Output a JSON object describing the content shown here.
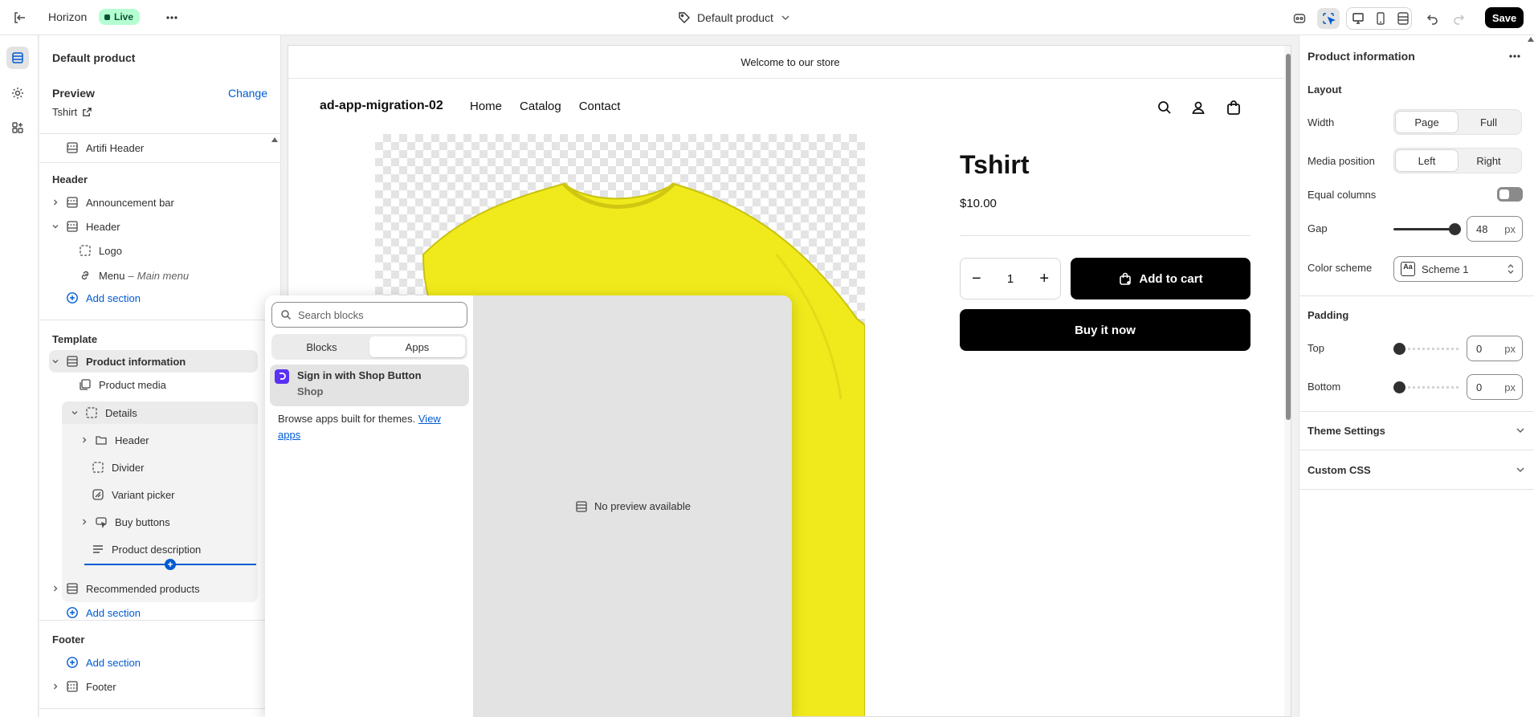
{
  "topbar": {
    "theme_name": "Horizon",
    "live_badge": "Live",
    "template_name": "Default product",
    "save_label": "Save"
  },
  "sidebar": {
    "title": "Default product",
    "preview_label": "Preview",
    "change_label": "Change",
    "preview_product": "Tshirt",
    "top_row": "Artifi Header",
    "header_group": {
      "title": "Header",
      "items": [
        "Announcement bar",
        "Header",
        "Logo",
        "Menu",
        "Main menu"
      ],
      "menu_separator": "–",
      "add_section": "Add section"
    },
    "template_group": {
      "title": "Template",
      "product_information": "Product information",
      "product_media": "Product media",
      "details": "Details",
      "details_children": [
        "Header",
        "Divider",
        "Variant picker",
        "Buy buttons",
        "Product description"
      ],
      "recommended": "Recommended products",
      "add_section": "Add section",
      "insert_plus": "+"
    },
    "footer_group": {
      "title": "Footer",
      "add_section": "Add section",
      "footer": "Footer"
    }
  },
  "preview": {
    "announcement": "Welcome to our store",
    "store_name": "ad-app-migration-02",
    "nav": [
      "Home",
      "Catalog",
      "Contact"
    ],
    "product_title": "Tshirt",
    "price": "$10.00",
    "quantity": "1",
    "qty_minus": "−",
    "qty_plus": "+",
    "add_to_cart": "Add to cart",
    "buy_now": "Buy it now",
    "shirt_color": "#f0ea1c"
  },
  "picker": {
    "search_placeholder": "Search blocks",
    "tabs": [
      "Blocks",
      "Apps"
    ],
    "active_tab": "Apps",
    "app_item": {
      "name": "Sign in with Shop Button",
      "vendor": "Shop"
    },
    "browse_text": "Browse apps built for themes.",
    "browse_link": "View apps",
    "no_preview": "No preview available"
  },
  "settings": {
    "title": "Product information",
    "layout_heading": "Layout",
    "width_label": "Width",
    "width_options": [
      "Page",
      "Full"
    ],
    "width_selected": "Page",
    "media_position_label": "Media position",
    "media_options": [
      "Left",
      "Right"
    ],
    "media_selected": "Left",
    "equal_columns_label": "Equal columns",
    "equal_columns_on": false,
    "gap_label": "Gap",
    "gap_value": "48",
    "gap_unit": "px",
    "gap_fraction": 1.0,
    "color_scheme_label": "Color scheme",
    "color_scheme_value": "Scheme 1",
    "color_scheme_swatch": "Aa",
    "padding_heading": "Padding",
    "top_label": "Top",
    "top_value": "0",
    "top_unit": "px",
    "bottom_label": "Bottom",
    "bottom_value": "0",
    "bottom_unit": "px",
    "theme_settings": "Theme Settings",
    "custom_css": "Custom CSS"
  },
  "colors": {
    "accent": "#005bd3",
    "live_bg": "#b4fed2",
    "shop_purple": "#5a31f4"
  }
}
